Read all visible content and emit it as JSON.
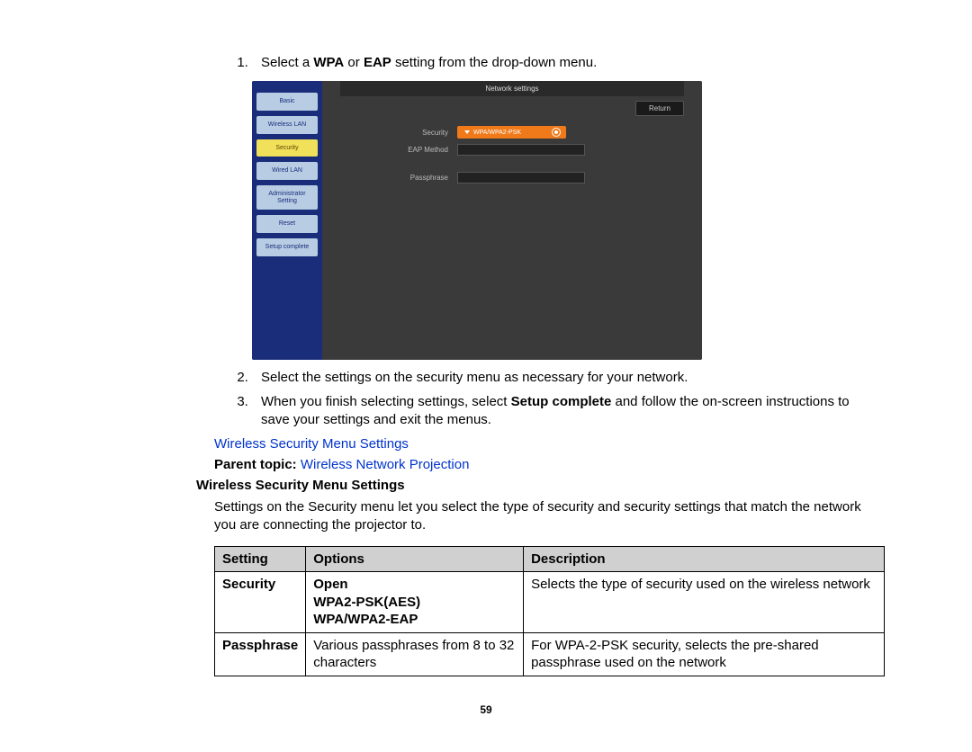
{
  "steps": {
    "s1_pre": "Select a ",
    "s1_b1": "WPA",
    "s1_mid": " or ",
    "s1_b2": "EAP",
    "s1_post": " setting from the drop-down menu.",
    "s2": "Select the settings on the security menu as necessary for your network.",
    "s3_pre": "When you finish selecting settings, select ",
    "s3_b": "Setup complete",
    "s3_post": " and follow the on-screen instructions to save your settings and exit the menus."
  },
  "screenshot": {
    "title": "Network settings",
    "return": "Return",
    "sidebar": [
      "Basic",
      "Wireless LAN",
      "Security",
      "Wired LAN",
      "Administrator Setting",
      "Reset",
      "Setup complete"
    ],
    "active_index": 2,
    "rows": {
      "security_label": "Security",
      "security_value": "WPA/WPA2-PSK",
      "eap_label": "EAP Method",
      "pass_label": "Passphrase"
    }
  },
  "link1": "Wireless Security Menu Settings",
  "parent_label": "Parent topic: ",
  "parent_link": "Wireless Network Projection",
  "heading": "Wireless Security Menu Settings",
  "body": "Settings on the Security menu let you select the type of security and security settings that match the network you are connecting the projector to.",
  "table": {
    "headers": [
      "Setting",
      "Options",
      "Description"
    ],
    "rows": [
      {
        "setting": "Security",
        "options": [
          "Open",
          "WPA2-PSK(AES)",
          "WPA/WPA2-EAP"
        ],
        "options_bold": true,
        "desc": "Selects the type of security used on the wireless network"
      },
      {
        "setting": "Passphrase",
        "options": [
          "Various passphrases from 8 to 32 characters"
        ],
        "options_bold": false,
        "desc": "For WPA-2-PSK security, selects the pre-shared passphrase used on the network"
      }
    ]
  },
  "page": "59"
}
